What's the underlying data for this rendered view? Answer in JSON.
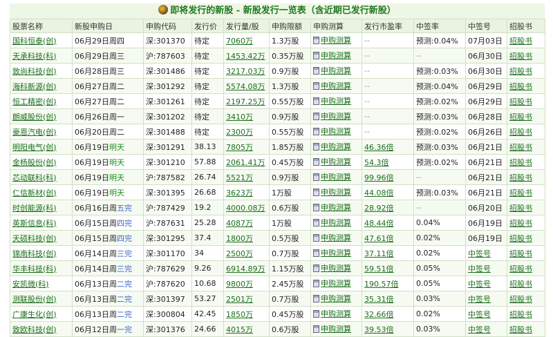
{
  "title": "即将发行的新股 - 新股发行一览表（含近期已发行新股）",
  "headers": [
    "股票名称",
    "新股申购日",
    "申购代码",
    "发行价",
    "发行量/股",
    "申购限额",
    "申购测算",
    "发行市盈率",
    "中签率",
    "中签号",
    "招股书"
  ],
  "calc_label": "申购测算",
  "prospectus_label": "招股书",
  "rows": [
    {
      "name": "国科恒泰(创)",
      "date": "06月29日周四",
      "date_suffix": "",
      "code": "深:301370",
      "price": "待定",
      "volume": "7060万",
      "limit": "1.3万股",
      "pe": "--",
      "rate": "预测:0.04%",
      "lucky": "07月03日"
    },
    {
      "name": "天承科技(科)",
      "date": "06月29日周",
      "date_suffix": "三",
      "code": "沪:787603",
      "price": "待定",
      "volume": "1453.42万",
      "limit": "0.35万股",
      "pe": "--",
      "rate": "--",
      "lucky": "06月30日"
    },
    {
      "name": "致尚科技(创)",
      "date": "06月28日周",
      "date_suffix": "三",
      "code": "深:301486",
      "price": "待定",
      "volume": "3217.03万",
      "limit": "0.9万股",
      "pe": "--",
      "rate": "预测:0.03%",
      "lucky": "06月30日"
    },
    {
      "name": "海科新源(创)",
      "date": "06月27日周",
      "date_suffix": "二",
      "code": "深:301292",
      "price": "待定",
      "volume": "5574.08万",
      "limit": "1.3万股",
      "pe": "--",
      "rate": "预测:0.04%",
      "lucky": "06月29日"
    },
    {
      "name": "恒工精密(创)",
      "date": "06月27日周",
      "date_suffix": "二",
      "code": "深:301261",
      "price": "待定",
      "volume": "2197.25万",
      "limit": "0.55万股",
      "pe": "--",
      "rate": "预测:0.02%",
      "lucky": "06月29日"
    },
    {
      "name": "朗威股份(创)",
      "date": "06月26日周",
      "date_suffix": "一",
      "code": "深:301202",
      "price": "待定",
      "volume": "3410万",
      "limit": "0.9万股",
      "pe": "--",
      "rate": "预测:0.03%",
      "lucky": "06月28日"
    },
    {
      "name": "豪恩汽电(创)",
      "date": "06月20日周",
      "date_suffix": "二",
      "code": "深:301488",
      "price": "待定",
      "volume": "2300万",
      "limit": "0.55万股",
      "pe": "--",
      "rate": "预测:0.02%",
      "lucky": "06月26日"
    },
    {
      "name": "明阳电气(创)",
      "date": "06月19日",
      "date_suffix": "明天",
      "code": "深:301291",
      "price": "38.13",
      "volume": "7805万",
      "limit": "1.85万股",
      "pe": "46.36倍",
      "rate": "预测:0.03%",
      "lucky": "06月21日"
    },
    {
      "name": "金杨股份(创)",
      "date": "06月19日",
      "date_suffix": "明天",
      "code": "深:301210",
      "price": "57.88",
      "volume": "2061.41万",
      "limit": "0.45万股",
      "pe": "54.3倍",
      "rate": "预测:0.02%",
      "lucky": "06月21日"
    },
    {
      "name": "芯动联科(科)",
      "date": "06月19日",
      "date_suffix": "明天",
      "code": "沪:787582",
      "price": "26.74",
      "volume": "5521万",
      "limit": "0.9万股",
      "pe": "99.96倍",
      "rate": "--",
      "lucky": "06月21日"
    },
    {
      "name": "仁信新材(创)",
      "date": "06月19日",
      "date_suffix": "明天",
      "code": "深:301395",
      "price": "26.68",
      "volume": "3623万",
      "limit": "1万股",
      "pe": "44.08倍",
      "rate": "预测:0.03%",
      "lucky": "06月21日"
    },
    {
      "name": "时创能源(科)",
      "date": "06月16日周",
      "date_suffix": "五完",
      "code": "沪:787429",
      "price": "19.2",
      "volume": "4000.08万",
      "limit": "0.6万股",
      "pe": "28.92倍",
      "rate": "--",
      "lucky": "06月20日"
    },
    {
      "name": "英斯信息(科)",
      "date": "06月15日周",
      "date_suffix": "四完",
      "code": "沪:787631",
      "price": "25.28",
      "volume": "4087万",
      "limit": "1万股",
      "pe": "48.44倍",
      "rate": "0.04%",
      "lucky": "06月19日"
    },
    {
      "name": "天硕科技(创)",
      "date": "06月15日周",
      "date_suffix": "四完",
      "code": "深:301295",
      "price": "37.4",
      "volume": "1800万",
      "limit": "0.5万股",
      "pe": "47.61倍",
      "rate": "0.02%",
      "lucky": "06月19日"
    },
    {
      "name": "锦南科技(创)",
      "date": "06月14日周",
      "date_suffix": "三完",
      "code": "深:301170",
      "price": "34",
      "volume": "2500万",
      "limit": "0.7万股",
      "pe": "37.11倍",
      "rate": "0.02%",
      "lucky": "中签号"
    },
    {
      "name": "华丰科技(科)",
      "date": "06月14日周",
      "date_suffix": "三完",
      "code": "沪:787629",
      "price": "9.26",
      "volume": "6914.89万",
      "limit": "1.15万股",
      "pe": "59.51倍",
      "rate": "0.05%",
      "lucky": "中签号"
    },
    {
      "name": "安凯微(科)",
      "date": "06月13日周",
      "date_suffix": "二完",
      "code": "沪:787620",
      "price": "10.68",
      "volume": "9800万",
      "limit": "2.45万股",
      "pe": "190.57倍",
      "rate": "0.05%",
      "lucky": "中签号"
    },
    {
      "name": "测联股份(创)",
      "date": "06月13日周",
      "date_suffix": "二完",
      "code": "深:301397",
      "price": "53.27",
      "volume": "2501万",
      "limit": "0.7万股",
      "pe": "35.31倍",
      "rate": "0.03%",
      "lucky": "中签号"
    },
    {
      "name": "广康生化(创)",
      "date": "06月13日周",
      "date_suffix": "二完",
      "code": "深:300804",
      "price": "42.45",
      "volume": "1850万",
      "limit": "0.45万股",
      "pe": "32.66倍",
      "rate": "0.02%",
      "lucky": "中签号"
    },
    {
      "name": "致欧科技(创)",
      "date": "06月12日周",
      "date_suffix": "一完",
      "code": "深:301376",
      "price": "24.66",
      "volume": "4015万",
      "limit": "0.6万股",
      "pe": "39.53倍",
      "rate": "0.03%",
      "lucky": "中签号"
    }
  ]
}
